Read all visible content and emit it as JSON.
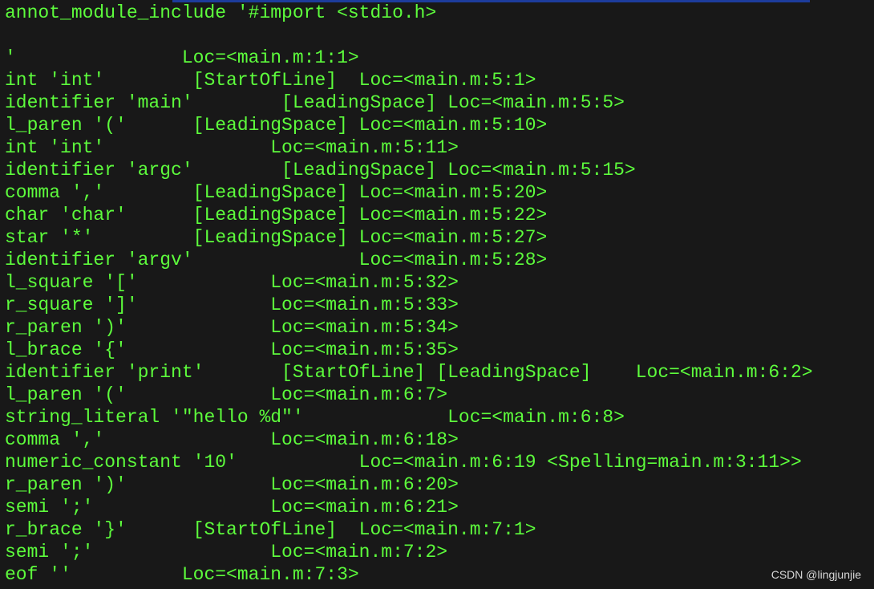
{
  "terminal": {
    "lines": [
      "annot_module_include '#import <stdio.h>",
      "",
      "'               Loc=<main.m:1:1>",
      "int 'int'        [StartOfLine]  Loc=<main.m:5:1>",
      "identifier 'main'        [LeadingSpace] Loc=<main.m:5:5>",
      "l_paren '('      [LeadingSpace] Loc=<main.m:5:10>",
      "int 'int'               Loc=<main.m:5:11>",
      "identifier 'argc'        [LeadingSpace] Loc=<main.m:5:15>",
      "comma ','        [LeadingSpace] Loc=<main.m:5:20>",
      "char 'char'      [LeadingSpace] Loc=<main.m:5:22>",
      "star '*'         [LeadingSpace] Loc=<main.m:5:27>",
      "identifier 'argv'               Loc=<main.m:5:28>",
      "l_square '['            Loc=<main.m:5:32>",
      "r_square ']'            Loc=<main.m:5:33>",
      "r_paren ')'             Loc=<main.m:5:34>",
      "l_brace '{'             Loc=<main.m:5:35>",
      "identifier 'print'       [StartOfLine] [LeadingSpace]    Loc=<main.m:6:2>",
      "l_paren '('             Loc=<main.m:6:7>",
      "string_literal '\"hello %d\"'             Loc=<main.m:6:8>",
      "comma ','               Loc=<main.m:6:18>",
      "numeric_constant '10'           Loc=<main.m:6:19 <Spelling=main.m:3:11>>",
      "r_paren ')'             Loc=<main.m:6:20>",
      "semi ';'                Loc=<main.m:6:21>",
      "r_brace '}'      [StartOfLine]  Loc=<main.m:7:1>",
      "semi ';'                Loc=<main.m:7:2>",
      "eof ''          Loc=<main.m:7:3>"
    ],
    "text_color": "#5dfc3c",
    "background": "#181818"
  },
  "watermark": "CSDN @lingjunjie"
}
